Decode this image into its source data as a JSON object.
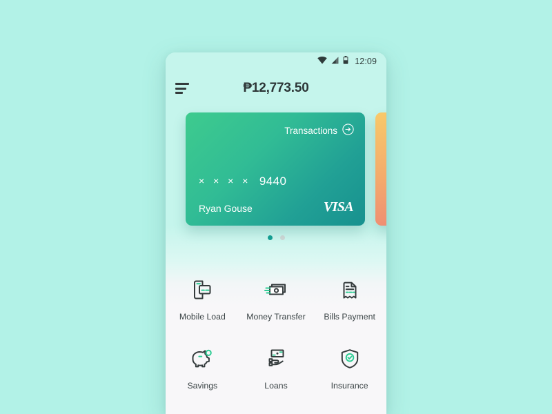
{
  "statusbar": {
    "time": "12:09",
    "icons": [
      "wifi-icon",
      "cellular-signal-icon",
      "battery-icon"
    ]
  },
  "appbar": {
    "menu_icon": "hamburger-menu-icon",
    "balance": "₱12,773.50"
  },
  "carousel": {
    "active_index": 0,
    "dots": [
      {
        "state": "active"
      },
      {
        "state": "inactive"
      }
    ],
    "cards": [
      {
        "transactions_label": "Transactions",
        "transactions_icon": "arrow-right-circle-icon",
        "masked_digits": "× × × ×",
        "last_four": "9440",
        "holder": "Ryan Gouse",
        "brand": "VISA",
        "gradient_from": "#3ecb8e",
        "gradient_to": "#17918f"
      },
      {
        "gradient_from": "#f8c96a",
        "gradient_to": "#eb7f76"
      }
    ]
  },
  "shortcuts": [
    {
      "label": "Mobile Load",
      "icon": "mobile-load-icon"
    },
    {
      "label": "Money Transfer",
      "icon": "money-transfer-icon"
    },
    {
      "label": "Bills Payment",
      "icon": "bills-payment-icon"
    },
    {
      "label": "Savings",
      "icon": "piggy-bank-icon"
    },
    {
      "label": "Loans",
      "icon": "hand-money-icon"
    },
    {
      "label": "Insurance",
      "icon": "shield-check-icon"
    }
  ],
  "theme": {
    "page_background": "#b2f2e7",
    "screen_top": "#c5f5ec",
    "screen_bottom": "#f8f7f9",
    "accent_green": "#2ecc94",
    "accent_teal": "#14a094",
    "icon_stroke": "#343b3c"
  }
}
